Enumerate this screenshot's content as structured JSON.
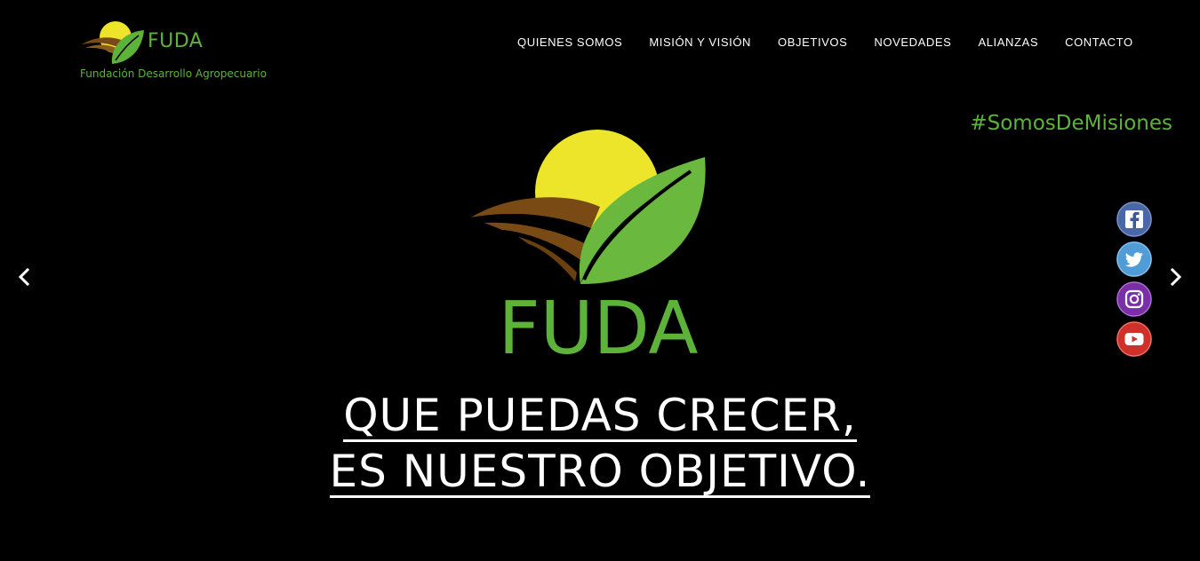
{
  "header": {
    "brand_name": "FUDA",
    "brand_tagline": "Fundación Desarrollo Agropecuario"
  },
  "nav": {
    "items": [
      {
        "label": "QUIENES SOMOS"
      },
      {
        "label": "MISIÓN Y VISIÓN"
      },
      {
        "label": "OBJETIVOS"
      },
      {
        "label": "NOVEDADES"
      },
      {
        "label": "ALIANZAS"
      },
      {
        "label": "CONTACTO"
      }
    ]
  },
  "hero": {
    "hashtag": "#SomosDeMisiones",
    "logo_text": "FUDA",
    "slogan_line1": "QUE PUEDAS CRECER,",
    "slogan_line2": "ES NUESTRO OBJETIVO."
  },
  "icons": {
    "prev": "chevron-left-icon",
    "next": "chevron-right-icon",
    "facebook": "facebook-icon",
    "twitter": "twitter-icon",
    "instagram": "instagram-icon",
    "youtube": "youtube-icon"
  },
  "colors": {
    "brand_green": "#5db33a",
    "sun_yellow": "#ede52a",
    "field_brown": "#7a4a14",
    "background": "#000000"
  }
}
